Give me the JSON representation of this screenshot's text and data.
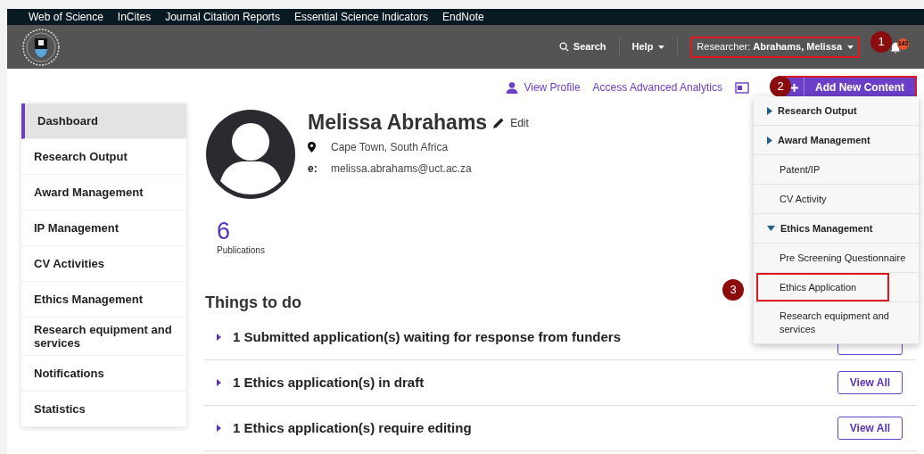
{
  "top_nav": [
    "Web of Science",
    "InCites",
    "Journal Citation Reports",
    "Essential Science Indicators",
    "EndNote"
  ],
  "header": {
    "search": "Search",
    "help": "Help",
    "user_prefix": "Researcher:",
    "user_name": "Abrahams, Melissa",
    "user_highlighted": true,
    "notification_count": "142"
  },
  "actions": {
    "view_profile": "View Profile",
    "analytics": "Access Advanced Analytics",
    "add_button": "Add New Content",
    "add_highlighted": true
  },
  "sidebar": [
    {
      "label": "Dashboard",
      "selected": true
    },
    {
      "label": "Research Output",
      "selected": false
    },
    {
      "label": "Award Management",
      "selected": false
    },
    {
      "label": "IP Management",
      "selected": false
    },
    {
      "label": "CV Activities",
      "selected": false
    },
    {
      "label": "Ethics Management",
      "selected": false
    },
    {
      "label": "Research equipment and services",
      "selected": false
    },
    {
      "label": "Notifications",
      "selected": false
    },
    {
      "label": "Statistics",
      "selected": false
    }
  ],
  "profile": {
    "name": "Melissa Abrahams",
    "edit": "Edit",
    "location": "Cape Town, South Africa",
    "email_label": "e:",
    "email": "melissa.abrahams@uct.ac.za",
    "count": "6",
    "count_label": "Publications"
  },
  "things_to_do": {
    "title": "Things to do",
    "rows": [
      {
        "text": "1 Submitted application(s) waiting for response from funders",
        "button_covered": true
      },
      {
        "text": "1 Ethics application(s) in draft",
        "button": "View All"
      },
      {
        "text": "1 Ethics application(s) require editing",
        "button": "View All"
      }
    ]
  },
  "dropdown": [
    {
      "kind": "group",
      "label": "Research Output",
      "expanded": false
    },
    {
      "kind": "group",
      "label": "Award Management",
      "expanded": false
    },
    {
      "kind": "item",
      "label": "Patent/IP",
      "highlighted": false
    },
    {
      "kind": "item",
      "label": "CV Activity",
      "highlighted": false
    },
    {
      "kind": "group",
      "label": "Ethics Management",
      "expanded": true
    },
    {
      "kind": "item",
      "label": "Pre Screening Questionnaire",
      "highlighted": false
    },
    {
      "kind": "item",
      "label": "Ethics Application",
      "highlighted": true
    },
    {
      "kind": "item",
      "label": "Research equipment and services",
      "highlighted": false
    }
  ],
  "annotations": [
    "1",
    "2",
    "3"
  ]
}
